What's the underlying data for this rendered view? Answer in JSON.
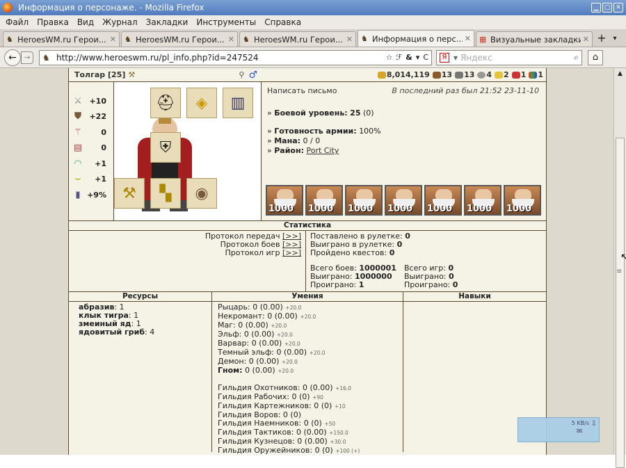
{
  "window": {
    "title": "Информация о персонаже. - Mozilla Firefox"
  },
  "menu": [
    "Файл",
    "Правка",
    "Вид",
    "Журнал",
    "Закладки",
    "Инструменты",
    "Справка"
  ],
  "tabs": [
    {
      "label": "HeroesWM.ru Герои..."
    },
    {
      "label": "HeroesWM.ru Герои..."
    },
    {
      "label": "HeroesWM.ru Герои..."
    },
    {
      "label": "Информация о перс..."
    },
    {
      "label": "Визуальные закладки"
    }
  ],
  "url": "http://www.heroeswm.ru/pl_info.php?id=247524",
  "search_placeholder": "Яндекс",
  "player": {
    "nick": "Толгар",
    "level_tag": "[25]",
    "gold": "8,014,119",
    "wood": "13",
    "ore": "13",
    "mercury": "4",
    "sulfur": "2",
    "crystals": "1",
    "gems": "1"
  },
  "stats": [
    {
      "icon": "attack-icon",
      "value": "+10"
    },
    {
      "icon": "defense-icon",
      "value": "+22"
    },
    {
      "icon": "spellpower-icon",
      "value": "0"
    },
    {
      "icon": "knowledge-icon",
      "value": "0"
    },
    {
      "icon": "luck-icon",
      "value": "+1"
    },
    {
      "icon": "morale-icon",
      "value": "+1"
    },
    {
      "icon": "initiative-icon",
      "value": "+9%"
    }
  ],
  "info": {
    "write": "Написать письмо",
    "last_seen": "В последний раз был 21:52 23-11-10",
    "battle_level_label": "Боевой уровень:",
    "battle_level": "25",
    "battle_level_extra": "(0)",
    "army_label": "Готовность армии:",
    "army": "100%",
    "mana_label": "Мана:",
    "mana": "0 / 0",
    "district_label": "Район:",
    "district": "Port City"
  },
  "troops": [
    "1000",
    "1000",
    "1000",
    "1000",
    "1000",
    "1000",
    "1000"
  ],
  "statistics": {
    "header": "Статистика",
    "protocols": [
      {
        "label": "Протокол передач",
        "link": "[>>]"
      },
      {
        "label": "Протокол боев",
        "link": "[>>]"
      },
      {
        "label": "Протокол игр",
        "link": "[>>]"
      }
    ],
    "roulette_bet_label": "Поставлено в рулетке:",
    "roulette_bet": "0",
    "roulette_won_label": "Выиграно в рулетке:",
    "roulette_won": "0",
    "quests_label": "Пройдено квестов:",
    "quests": "0",
    "battles_total_label": "Всего боев:",
    "battles_total": "1000001",
    "battles_won_label": "Выиграно:",
    "battles_won": "1000000",
    "battles_lost_label": "Проиграно:",
    "battles_lost": "1",
    "games_total_label": "Всего игр:",
    "games_total": "0",
    "games_won_label": "Выиграно:",
    "games_won": "0",
    "games_lost_label": "Проиграно:",
    "games_lost": "0"
  },
  "resources": {
    "header": "Ресурсы",
    "items": [
      {
        "name": "абразив",
        "count": "1"
      },
      {
        "name": "клык тигра",
        "count": "1"
      },
      {
        "name": "змеиный яд",
        "count": "1"
      },
      {
        "name": "ядовитый гриб",
        "count": "4"
      }
    ]
  },
  "skills": {
    "header": "Умения",
    "factions": [
      {
        "name": "Рыцарь:",
        "value": "0 (0.00)",
        "bonus": "+20.0"
      },
      {
        "name": "Некромант:",
        "value": "0 (0.00)",
        "bonus": "+20.0"
      },
      {
        "name": "Маг:",
        "value": "0 (0.00)",
        "bonus": "+20.0"
      },
      {
        "name": "Эльф:",
        "value": "0 (0.00)",
        "bonus": "+20.0"
      },
      {
        "name": "Варвар:",
        "value": "0 (0.00)",
        "bonus": "+20.0"
      },
      {
        "name": "Темный эльф:",
        "value": "0 (0.00)",
        "bonus": "+20.0"
      },
      {
        "name": "Демон:",
        "value": "0 (0.00)",
        "bonus": "+20.0"
      },
      {
        "name": "Гном:",
        "value": "0 (0.00)",
        "bonus": "+20.0"
      }
    ],
    "guilds": [
      {
        "name": "Гильдия Охотников:",
        "value": "0 (0.00)",
        "bonus": "+16.0"
      },
      {
        "name": "Гильдия Рабочих:",
        "value": "0 (0)",
        "bonus": "+90"
      },
      {
        "name": "Гильдия Картежников:",
        "value": "0 (0)",
        "bonus": "+10"
      },
      {
        "name": "Гильдия Воров:",
        "value": "0 (0)",
        "bonus": ""
      },
      {
        "name": "Гильдия Наемников:",
        "value": "0 (0)",
        "bonus": "+50"
      },
      {
        "name": "Гильдия Тактиков:",
        "value": "0 (0.00)",
        "bonus": "+150.0"
      },
      {
        "name": "Гильдия Кузнецов:",
        "value": "0 (0.00)",
        "bonus": "+30.0"
      },
      {
        "name": "Гильдия Оружейников:",
        "value": "0 (0)",
        "bonus": "+100 (+)"
      }
    ]
  },
  "talents": {
    "header": "Навыки"
  },
  "download": {
    "speed": "5 KB/s"
  }
}
